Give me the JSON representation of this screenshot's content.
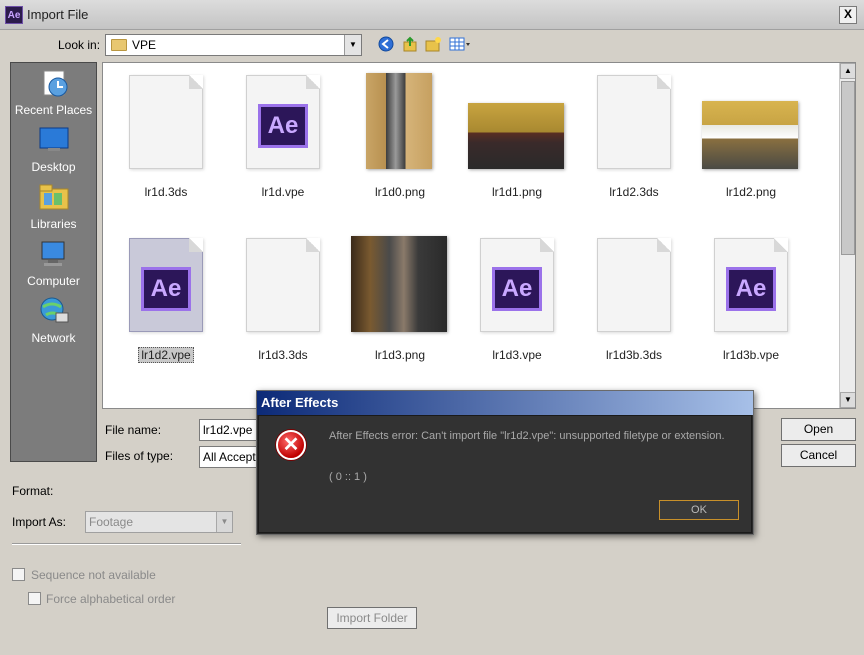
{
  "window": {
    "title": "Import File",
    "app_icon": "Ae",
    "close_label": "X"
  },
  "lookin": {
    "label": "Look in:",
    "value": "VPE"
  },
  "places": [
    {
      "label": "Recent Places",
      "icon": "recent-places-icon"
    },
    {
      "label": "Desktop",
      "icon": "desktop-icon"
    },
    {
      "label": "Libraries",
      "icon": "libraries-icon"
    },
    {
      "label": "Computer",
      "icon": "computer-icon"
    },
    {
      "label": "Network",
      "icon": "network-icon"
    }
  ],
  "files": [
    {
      "name": "lr1d.3ds",
      "kind": "blank"
    },
    {
      "name": "lr1d.vpe",
      "kind": "ae"
    },
    {
      "name": "lr1d0.png",
      "kind": "photo"
    },
    {
      "name": "lr1d1.png",
      "kind": "photo"
    },
    {
      "name": "lr1d2.3ds",
      "kind": "blank"
    },
    {
      "name": "lr1d2.png",
      "kind": "photo"
    },
    {
      "name": "lr1d2.vpe",
      "kind": "ae",
      "selected": true
    },
    {
      "name": "lr1d3.3ds",
      "kind": "blank"
    },
    {
      "name": "lr1d3.png",
      "kind": "photo"
    },
    {
      "name": "lr1d3.vpe",
      "kind": "ae"
    },
    {
      "name": "lr1d3b.3ds",
      "kind": "blank"
    },
    {
      "name": "lr1d3b.vpe",
      "kind": "ae"
    }
  ],
  "ae_badge_text": "Ae",
  "form": {
    "filename_label": "File name:",
    "filename_value": "lr1d2.vpe",
    "filetype_label": "Files of type:",
    "filetype_value": "All Accepta",
    "open_label": "Open",
    "cancel_label": "Cancel",
    "format_label": "Format:",
    "import_as_label": "Import As:",
    "import_as_value": "Footage",
    "sequence_label": "Sequence not available",
    "force_alpha_label": "Force alphabetical order",
    "import_folder_label": "Import Folder"
  },
  "error_dialog": {
    "title": "After Effects",
    "message": "After Effects error: Can't import file \"lr1d2.vpe\": unsupported filetype or extension.",
    "code": "( 0 :: 1 )",
    "ok_label": "OK"
  },
  "colors": {
    "dialog_title_start": "#0c2a78",
    "dialog_body": "#323232",
    "error_red": "#c00000",
    "ae_purple": "#9b72ea"
  }
}
